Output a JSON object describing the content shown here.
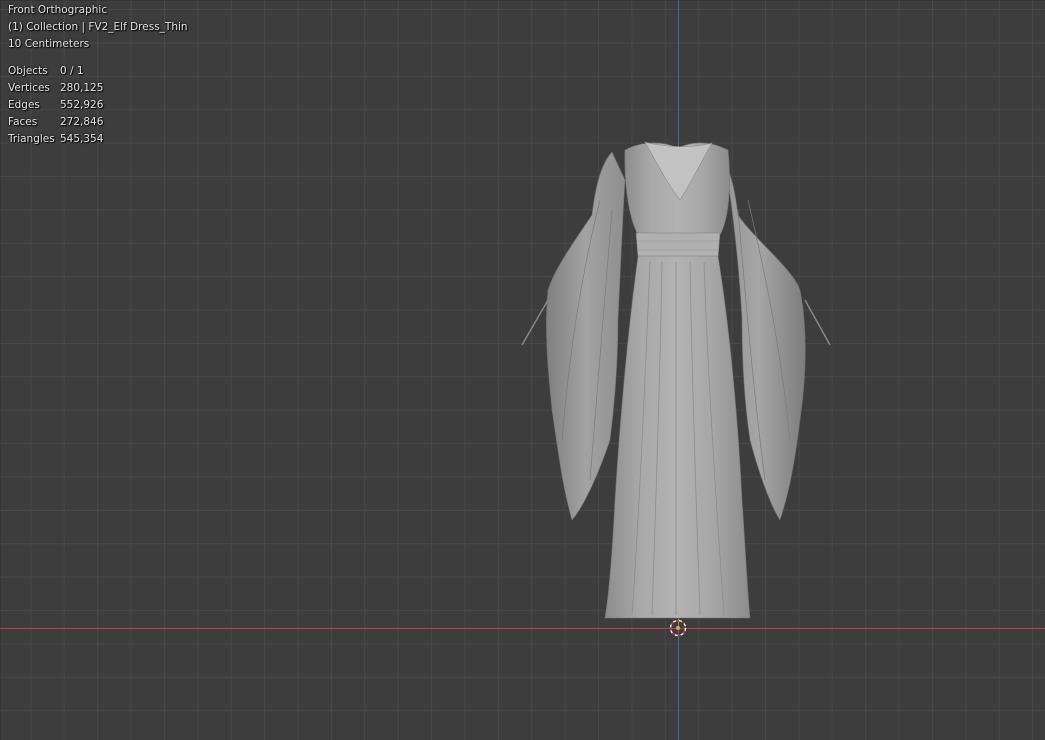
{
  "viewport": {
    "view_name": "Front Orthographic",
    "collection_line": "(1) Collection | FV2_Elf Dress_Thin",
    "grid_scale": "10 Centimeters"
  },
  "stats": [
    {
      "label": "Objects",
      "value": "0 / 1"
    },
    {
      "label": "Vertices",
      "value": "280,125"
    },
    {
      "label": "Edges",
      "value": "552,926"
    },
    {
      "label": "Faces",
      "value": "272,846"
    },
    {
      "label": "Triangles",
      "value": "545,354"
    }
  ],
  "colors": {
    "background": "#3d3d3d",
    "grid": "#494949",
    "x_axis": "#b9434d",
    "z_axis": "#3a6ea8",
    "mesh": "#9a9a9a"
  },
  "object": {
    "icon": "dress-mesh",
    "origin_icon": "3d-cursor-icon"
  }
}
